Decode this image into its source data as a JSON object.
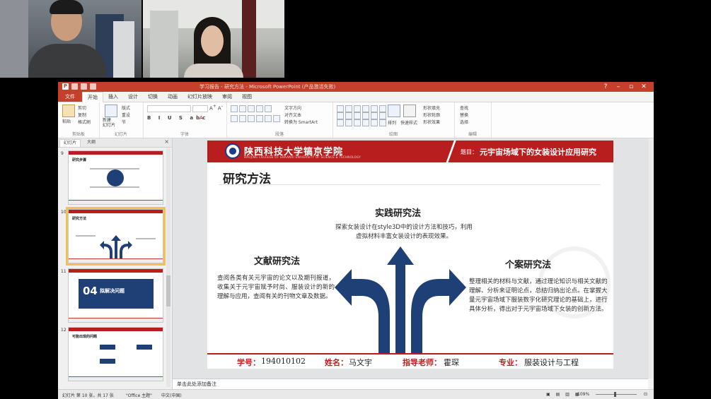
{
  "colors": {
    "ppt_red": "#c5402b",
    "slide_red": "#b81e1e",
    "arrow_blue": "#1f3f77"
  },
  "window": {
    "title": "学习报告 - 研究方法 - Microsoft PowerPoint (产品激活失败)"
  },
  "tabs": [
    "文件",
    "开始",
    "插入",
    "设计",
    "切换",
    "动画",
    "幻灯片放映",
    "审阅",
    "视图"
  ],
  "ribbon": {
    "clipboard": {
      "paste": "粘贴",
      "cut": "剪切",
      "copy": "复制",
      "format": "格式刷",
      "label": "剪贴板"
    },
    "slides": {
      "new": "新建\n幻灯片",
      "layout": "版式",
      "reset": "重设",
      "section": "节",
      "label": "幻灯片"
    },
    "font": {
      "label": "字体"
    },
    "paragraph": {
      "direction": "文字方向",
      "align": "对齐文本",
      "smartart": "转换为 SmartArt",
      "label": "段落"
    },
    "drawing": {
      "arrange": "排列",
      "styles": "快速样式",
      "fill": "形状填充",
      "outline": "形状轮廓",
      "effects": "形状效果",
      "label": "绘图"
    },
    "editing": {
      "find": "查找",
      "replace": "替换",
      "select": "选择",
      "label": "编辑"
    }
  },
  "pane": {
    "tabs": [
      "幻灯片",
      "大纲"
    ],
    "thumbs": [
      {
        "num": "9",
        "title": "研究步骤"
      },
      {
        "num": "10",
        "title": "研究方法"
      },
      {
        "num": "11",
        "big": "04",
        "title": "拟解决问题"
      },
      {
        "num": "12",
        "title": "可能出现的问题"
      }
    ]
  },
  "slide": {
    "school": "陕西科技大学镐京学院",
    "school_en": "HAOJING COLLEGE OF SHAANXI UNIVERSITY OF SCIENCE & TECHNOLOGY",
    "topic_label": "题目：",
    "topic": "元宇宙场域下的女装设计应用研究",
    "title": "研究方法",
    "methods": {
      "practice": {
        "heading": "实践研究法",
        "text": "探索女装设计在style3D中的设计方法和技巧，利用虚拟材料丰富女装设计的表现效果。"
      },
      "literature": {
        "heading": "文献研究法",
        "text": "查阅各类有关元宇宙的论文以及期刊报道，收集关于元宇宙赋予时尚、服装设计的新的理解与应用，查阅有关的刊物文章及数据。"
      },
      "case": {
        "heading": "个案研究法",
        "text": "整理相关的材料与文献，通过理论知识与相关文献的理解、分析来证明论点，总结归纳出论点。在掌握大量元宇宙场域下服装数字化研究理论的基础上，进行具体分析，得出对于元宇宙场域下女装的创新方法。"
      }
    },
    "footer": {
      "id_label": "学号：",
      "id": "194010102",
      "name_label": "姓名：",
      "name": "马文宇",
      "advisor_label": "指导老师：",
      "advisor": "霍琛",
      "major_label": "专业：",
      "major": "服装设计与工程"
    }
  },
  "notes_placeholder": "单击此处添加备注",
  "status": {
    "slide": "幻灯片 第 10 张，共 17 张",
    "theme": "\"Office 主题\"",
    "lang": "中文(中国)",
    "zoom": "109%"
  }
}
